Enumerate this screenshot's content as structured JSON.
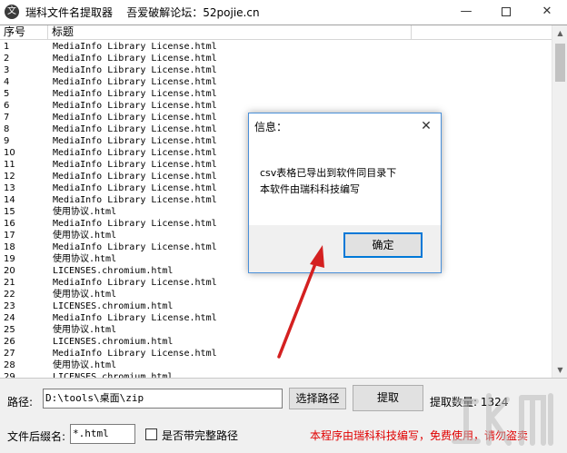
{
  "window": {
    "title": "瑞科文件名提取器    吾爱破解论坛：52pojie.cn",
    "icon_glyph": "文",
    "minimize": "—",
    "close": "✕"
  },
  "list": {
    "columns": [
      "序号",
      "标题"
    ],
    "rows": [
      [
        "1",
        "MediaInfo Library License.html"
      ],
      [
        "2",
        "MediaInfo Library License.html"
      ],
      [
        "3",
        "MediaInfo Library License.html"
      ],
      [
        "4",
        "MediaInfo Library License.html"
      ],
      [
        "5",
        "MediaInfo Library License.html"
      ],
      [
        "6",
        "MediaInfo Library License.html"
      ],
      [
        "7",
        "MediaInfo Library License.html"
      ],
      [
        "8",
        "MediaInfo Library License.html"
      ],
      [
        "9",
        "MediaInfo Library License.html"
      ],
      [
        "10",
        "MediaInfo Library License.html"
      ],
      [
        "11",
        "MediaInfo Library License.html"
      ],
      [
        "12",
        "MediaInfo Library License.html"
      ],
      [
        "13",
        "MediaInfo Library License.html"
      ],
      [
        "14",
        "MediaInfo Library License.html"
      ],
      [
        "15",
        "使用协议.html"
      ],
      [
        "16",
        "MediaInfo Library License.html"
      ],
      [
        "17",
        "使用协议.html"
      ],
      [
        "18",
        "MediaInfo Library License.html"
      ],
      [
        "19",
        "使用协议.html"
      ],
      [
        "20",
        "LICENSES.chromium.html"
      ],
      [
        "21",
        "MediaInfo Library License.html"
      ],
      [
        "22",
        "使用协议.html"
      ],
      [
        "23",
        "LICENSES.chromium.html"
      ],
      [
        "24",
        "MediaInfo Library License.html"
      ],
      [
        "25",
        "使用协议.html"
      ],
      [
        "26",
        "LICENSES.chromium.html"
      ],
      [
        "27",
        "MediaInfo Library License.html"
      ],
      [
        "28",
        "使用协议.html"
      ],
      [
        "29",
        "LICENSES.chromium.html"
      ]
    ]
  },
  "controls": {
    "path_label": "路径:",
    "path_value": "D:\\tools\\桌面\\zip",
    "choose_path_button": "选择路径",
    "extract_button": "提取",
    "count_text": "提取数量: 1324",
    "ext_label": "文件后缀名:",
    "ext_value": "*.html",
    "full_path_checkbox": "是否带完整路径",
    "note": "本程序由瑞科科技编写，免费使用，请勿盗卖"
  },
  "dialog": {
    "title": "信息：",
    "close": "✕",
    "line1": "csv表格已导出到软件同目录下",
    "line2": "本软件由瑞科科技编写",
    "ok_button": "确定"
  },
  "colors": {
    "note_red": "#e00000",
    "arrow_red": "#d42020",
    "dialog_border": "#4a90d9"
  }
}
